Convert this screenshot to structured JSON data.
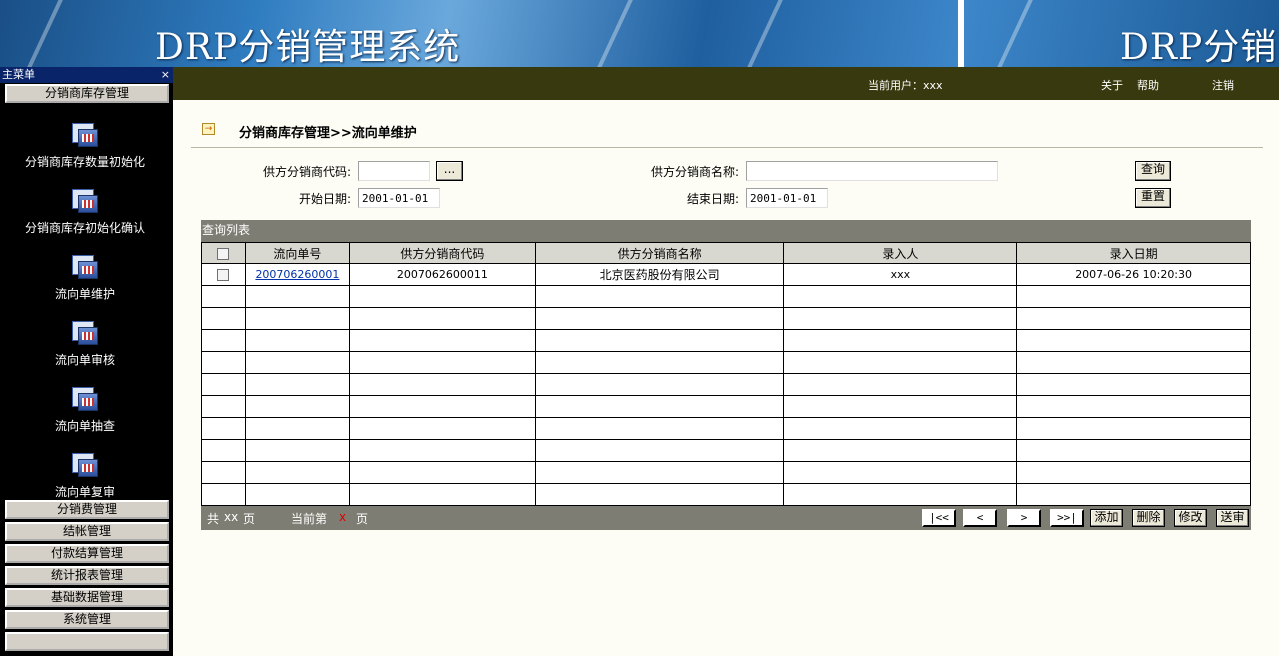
{
  "banner": {
    "title": "DRP分销管理系统",
    "title_repeat": "DRP分销"
  },
  "sidebar": {
    "header": "主菜单",
    "close": "×",
    "active_category": "分销商库存管理",
    "items": [
      {
        "label": "分销商库存数量初始化",
        "icon": "window-table-icon"
      },
      {
        "label": "分销商库存初始化确认",
        "icon": "window-table-icon"
      },
      {
        "label": "流向单维护",
        "icon": "window-table-icon"
      },
      {
        "label": "流向单审核",
        "icon": "window-table-icon"
      },
      {
        "label": "流向单抽查",
        "icon": "window-table-icon"
      },
      {
        "label": "流向单复审",
        "icon": "window-table-icon"
      }
    ],
    "scroll_down": "▼",
    "categories": [
      "分销费管理",
      "结帐管理",
      "付款结算管理",
      "统计报表管理",
      "基础数据管理",
      "系统管理"
    ]
  },
  "topbar": {
    "current_user": "当前用户：xxx",
    "about": "关于",
    "help": "帮助",
    "logout": "注销"
  },
  "page": {
    "title_icon": "→",
    "title": "分销商库存管理>>流向单维护"
  },
  "search": {
    "supplier_code_label": "供方分销商代码:",
    "supplier_code_value": "",
    "browse_btn": "...",
    "supplier_name_label": "供方分销商名称:",
    "supplier_name_value": "",
    "query_btn": "查询",
    "start_date_label": "开始日期:",
    "start_date_value": "2001-01-01",
    "end_date_label": "结束日期:",
    "end_date_value": "2001-01-01",
    "reset_btn": "重置"
  },
  "grid": {
    "title": "查询列表",
    "columns": [
      "流向单号",
      "供方分销商代码",
      "供方分销商名称",
      "录入人",
      "录入日期"
    ],
    "rows": [
      [
        "200706260001",
        "2007062600011",
        "北京医药股份有限公司",
        "xxx",
        "2007-06-26 10:20:30"
      ]
    ],
    "empty_rows": 10
  },
  "footer": {
    "total_pre": "共",
    "total_val": "xx",
    "total_post": "页",
    "current_pre": "当前第",
    "current_val": "x",
    "current_post": "页",
    "first": "|<<",
    "prev": "<",
    "next": ">",
    "last": ">>|",
    "add": "添加",
    "delete": "删除",
    "modify": "修改",
    "submit": "送审"
  }
}
